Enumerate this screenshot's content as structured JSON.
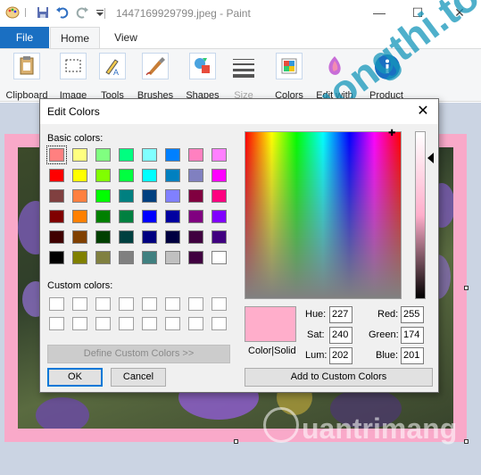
{
  "titlebar": {
    "title": "1447169929799.jpeg - Paint",
    "minimize": "—",
    "maximize": "☐",
    "close": "✕"
  },
  "ribbon": {
    "tabs": [
      {
        "label": "File"
      },
      {
        "label": "Home"
      },
      {
        "label": "View"
      }
    ],
    "groups": [
      {
        "label": "Clipboard",
        "icon": "clipboard-icon"
      },
      {
        "label": "Image",
        "icon": "select-icon"
      },
      {
        "label": "Tools",
        "icon": "pencil-icon"
      },
      {
        "label": "Brushes",
        "icon": "brush-icon"
      },
      {
        "label": "Shapes",
        "icon": "shapes-icon"
      },
      {
        "label": "Size",
        "icon": "size-icon"
      },
      {
        "label": "Colors",
        "icon": "palette-icon"
      },
      {
        "label": "Edit with",
        "icon": "paint3d-icon"
      },
      {
        "label": "Product",
        "icon": "info-icon"
      }
    ]
  },
  "dialog": {
    "title": "Edit Colors",
    "close": "✕",
    "basic_colors_label": "Basic colors:",
    "custom_colors_label": "Custom colors:",
    "basic_colors": [
      "#ff8080",
      "#ffff80",
      "#80ff80",
      "#00ff80",
      "#80ffff",
      "#0080ff",
      "#ff80c0",
      "#ff80ff",
      "#ff0000",
      "#ffff00",
      "#80ff00",
      "#00ff40",
      "#00ffff",
      "#0080c0",
      "#8080c0",
      "#ff00ff",
      "#804040",
      "#ff8040",
      "#00ff00",
      "#008080",
      "#004080",
      "#8080ff",
      "#800040",
      "#ff0080",
      "#800000",
      "#ff8000",
      "#008000",
      "#008040",
      "#0000ff",
      "#0000a0",
      "#800080",
      "#8000ff",
      "#400000",
      "#804000",
      "#004000",
      "#004040",
      "#000080",
      "#000040",
      "#400040",
      "#400080",
      "#000000",
      "#808000",
      "#808040",
      "#808080",
      "#408080",
      "#c0c0c0",
      "#400040",
      "#ffffff"
    ],
    "define_custom_label": "Define Custom Colors >>",
    "ok_label": "OK",
    "cancel_label": "Cancel",
    "color_solid_label": "Color|Solid",
    "hue_label": "Hue:",
    "hue": "227",
    "sat_label": "Sat:",
    "sat": "240",
    "lum_label": "Lum:",
    "lum": "202",
    "red_label": "Red:",
    "red": "255",
    "green_label": "Green:",
    "green": "174",
    "blue_label": "Blue:",
    "blue": "201",
    "add_custom_label": "Add to Custom Colors",
    "current_color": "#ffaecb"
  },
  "watermarks": {
    "top": "Truongthi.top",
    "bottom": "uantrimang"
  }
}
